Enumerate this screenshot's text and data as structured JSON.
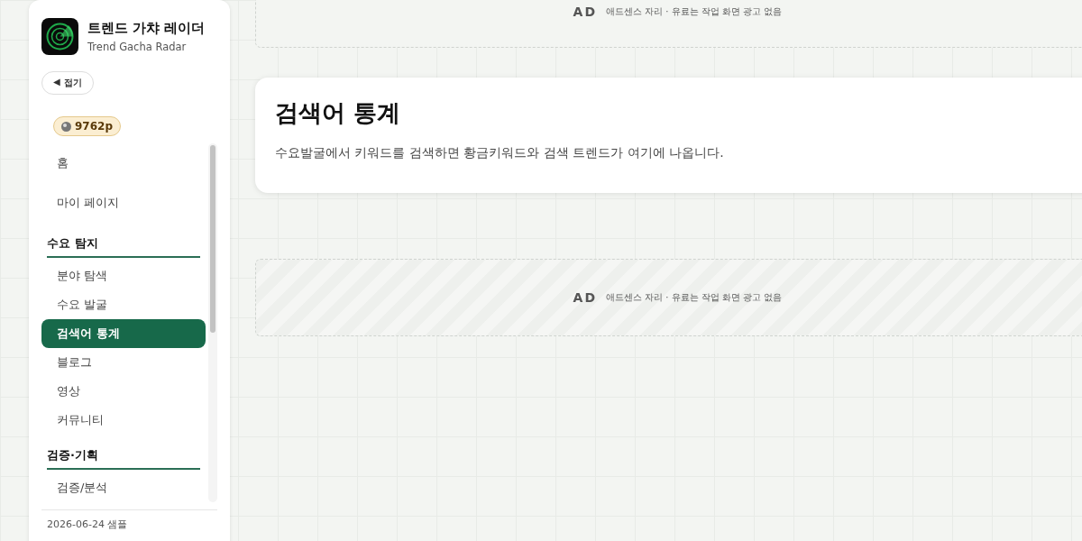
{
  "brand": {
    "title": "트렌드 가챠 레이더",
    "subtitle": "Trend Gacha Radar"
  },
  "collapse_button": {
    "icon": "◀",
    "label": "접기"
  },
  "points": "9762p",
  "nav": [
    {
      "kind": "item",
      "label": "홈",
      "selected": false
    },
    {
      "kind": "item",
      "label": "마이 페이지",
      "selected": false
    },
    {
      "kind": "header",
      "label": "수요 탐지"
    },
    {
      "kind": "item",
      "label": "분야 탐색",
      "selected": false
    },
    {
      "kind": "item",
      "label": "수요 발굴",
      "selected": false
    },
    {
      "kind": "item",
      "label": "검색어 통계",
      "selected": true
    },
    {
      "kind": "item",
      "label": "블로그",
      "selected": false
    },
    {
      "kind": "item",
      "label": "영상",
      "selected": false
    },
    {
      "kind": "item",
      "label": "커뮤니티",
      "selected": false
    },
    {
      "kind": "header",
      "label": "검증·기획"
    },
    {
      "kind": "item",
      "label": "검증/분석",
      "selected": false
    }
  ],
  "footer": "2026-06-24 샘플",
  "ads": [
    {
      "kind": "plain",
      "tag": "AD",
      "text": "애드센스 자리 · 유료는 작업 화면 광고 없음"
    },
    {
      "kind": "striped",
      "tag": "AD",
      "text": "애드센스 자리 · 유료는 작업 화면 광고 없음"
    }
  ],
  "card": {
    "title": "검색어 통계",
    "description": "수요발굴에서 키워드를 검색하면 황금키워드와 검색 트렌드가 여기에 나옵니다."
  }
}
